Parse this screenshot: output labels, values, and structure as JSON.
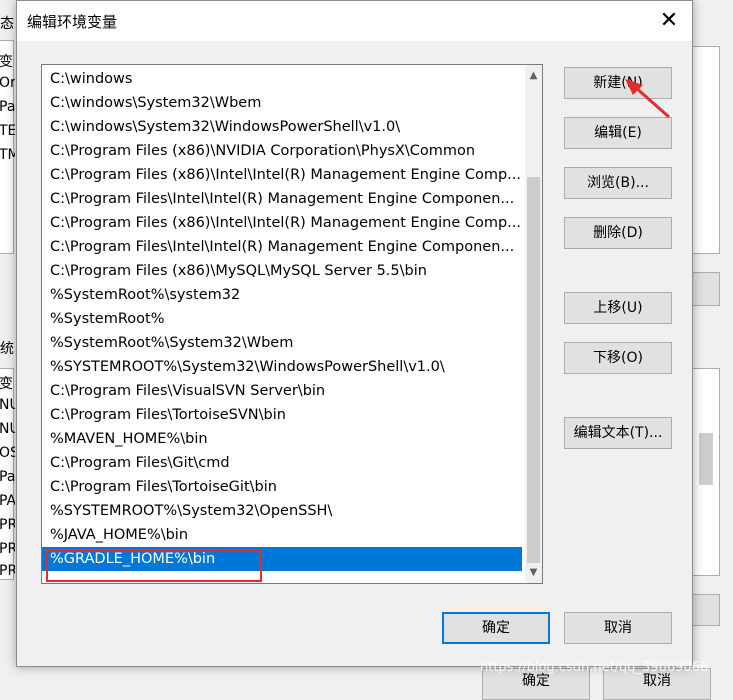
{
  "background": {
    "left_fragments": [
      "态",
      "变",
      "Or",
      "Pa",
      "TE",
      "TM",
      "统",
      "变",
      "NU",
      "NU",
      "OS",
      "Pa",
      "PA",
      "PR",
      "PR",
      "PR"
    ],
    "bottom_buttons": [
      "确定",
      "取消"
    ]
  },
  "dialog": {
    "title": "编辑环境变量",
    "close_icon": "close-icon"
  },
  "path_list": {
    "items": [
      "C:\\windows",
      "C:\\windows\\System32\\Wbem",
      "C:\\windows\\System32\\WindowsPowerShell\\v1.0\\",
      "C:\\Program Files (x86)\\NVIDIA Corporation\\PhysX\\Common",
      "C:\\Program Files (x86)\\Intel\\Intel(R) Management Engine Comp...",
      "C:\\Program Files\\Intel\\Intel(R) Management Engine Componen...",
      "C:\\Program Files (x86)\\Intel\\Intel(R) Management Engine Comp...",
      "C:\\Program Files\\Intel\\Intel(R) Management Engine Componen...",
      "C:\\Program Files (x86)\\MySQL\\MySQL Server 5.5\\bin",
      "%SystemRoot%\\system32",
      "%SystemRoot%",
      "%SystemRoot%\\System32\\Wbem",
      "%SYSTEMROOT%\\System32\\WindowsPowerShell\\v1.0\\",
      "C:\\Program Files\\VisualSVN Server\\bin",
      "C:\\Program Files\\TortoiseSVN\\bin",
      "%MAVEN_HOME%\\bin",
      "C:\\Program Files\\Git\\cmd",
      "C:\\Program Files\\TortoiseGit\\bin",
      "%SYSTEMROOT%\\System32\\OpenSSH\\",
      "%JAVA_HOME%\\bin",
      "%GRADLE_HOME%\\bin"
    ],
    "selected_index": 20
  },
  "buttons": {
    "new": "新建(N)",
    "edit": "编辑(E)",
    "browse": "浏览(B)...",
    "delete": "删除(D)",
    "move_up": "上移(U)",
    "move_down": "下移(O)",
    "edit_text": "编辑文本(T)...",
    "ok": "确定",
    "cancel": "取消"
  },
  "watermark": "https://blog.csdn.net/qq_39669066",
  "colors": {
    "selection": "#0078d7",
    "annotation": "#e52b2b"
  }
}
